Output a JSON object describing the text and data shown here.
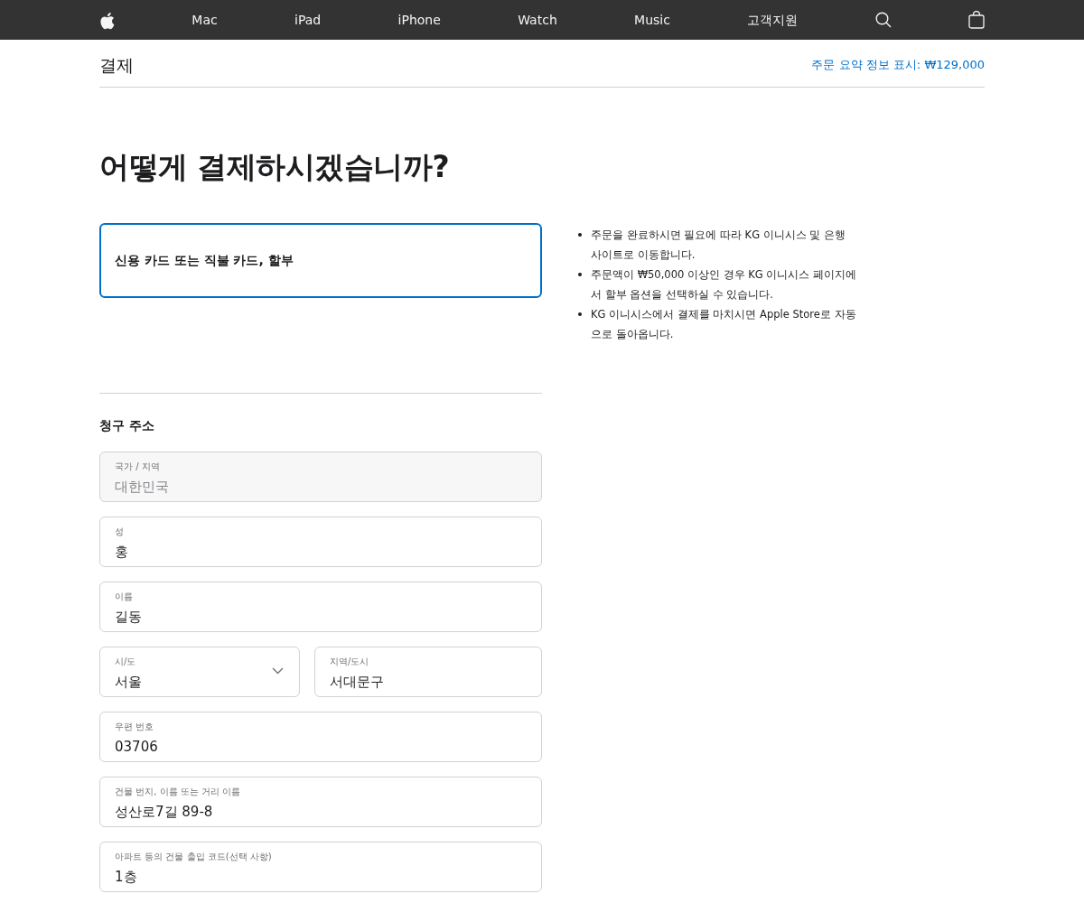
{
  "nav": {
    "items": [
      "Mac",
      "iPad",
      "iPhone",
      "Watch",
      "Music",
      "고객지원"
    ]
  },
  "header": {
    "title": "결제",
    "summary_link": "주문 요약 정보 표시: ₩129,000"
  },
  "heading": "어떻게 결제하시겠습니까?",
  "payment_options": [
    {
      "label": "신용 카드 또는 직불 카드, 할부",
      "selected": true
    }
  ],
  "info": [
    "주문을 완료하시면 필요에 따라 KG 이니시스 및 은행 사이트로 이동합니다.",
    "주문액이 ₩50,000 이상인 경우 KG 이니시스 페이지에서 할부 옵션을 선택하실 수 있습니다.",
    "KG 이니시스에서 결제를 마치시면 Apple Store로 자동으로 돌아옵니다."
  ],
  "billing": {
    "title": "청구 주소",
    "rows": [
      [
        {
          "kind": "text",
          "label": "국가 / 지역",
          "value": "대한민국",
          "disabled": true
        }
      ],
      [
        {
          "kind": "text",
          "label": "성",
          "value": "홍",
          "disabled": false
        }
      ],
      [
        {
          "kind": "text",
          "label": "이름",
          "value": "길동",
          "disabled": false
        }
      ],
      [
        {
          "kind": "select",
          "label": "시/도",
          "value": "서울",
          "disabled": false
        },
        {
          "kind": "text",
          "label": "지역/도시",
          "value": "서대문구",
          "disabled": false
        }
      ],
      [
        {
          "kind": "text",
          "label": "우편 번호",
          "value": "03706",
          "disabled": false
        }
      ],
      [
        {
          "kind": "text",
          "label": "건물 번지, 이름 또는 거리 이름",
          "value": "성산로7길 89-8",
          "disabled": false
        }
      ],
      [
        {
          "kind": "text",
          "label": "아파트 등의 건물 출입 코드(선택 사항)",
          "value": "1층",
          "disabled": false
        }
      ]
    ]
  }
}
